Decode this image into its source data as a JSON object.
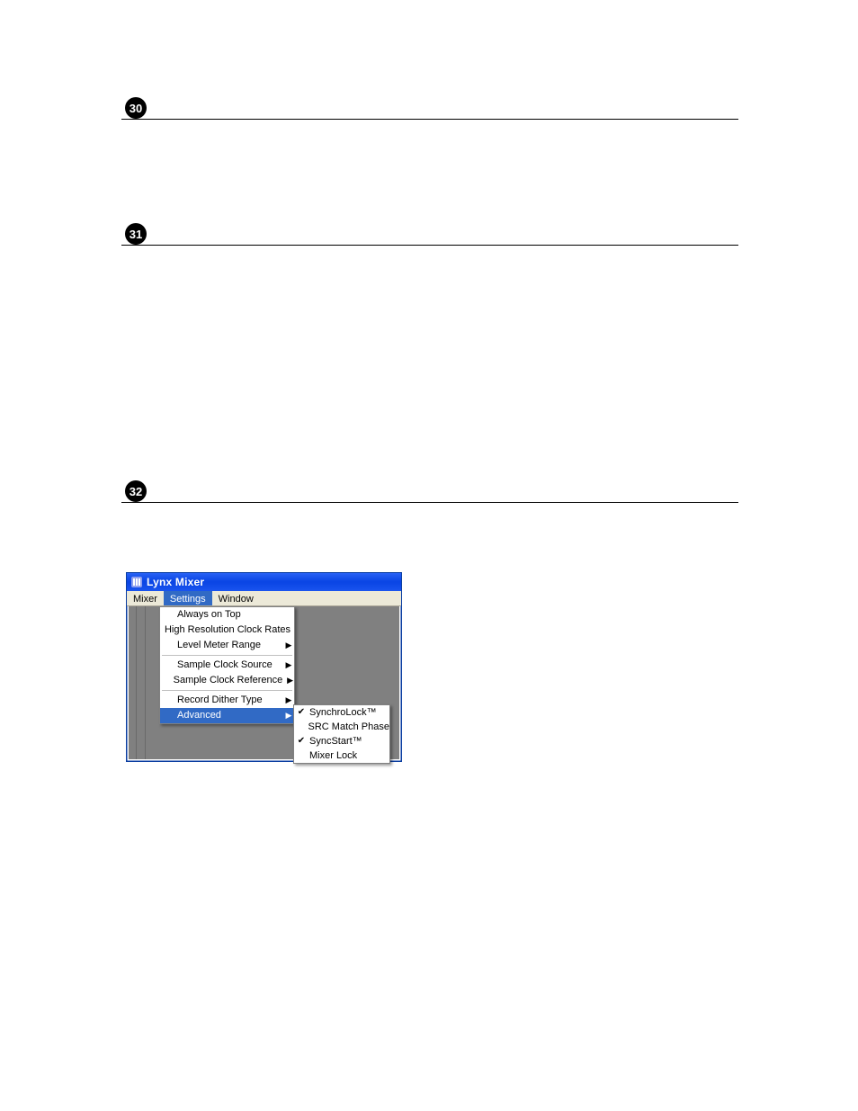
{
  "bullets": {
    "b30": "30",
    "b31": "31",
    "b32": "32"
  },
  "window": {
    "title": "Lynx Mixer",
    "menubar": {
      "items": [
        {
          "label": "Mixer",
          "active": false
        },
        {
          "label": "Settings",
          "active": true
        },
        {
          "label": "Window",
          "active": false
        }
      ]
    }
  },
  "settings_menu": {
    "items": [
      {
        "label": "Always on Top",
        "submenu": false,
        "highlighted": false
      },
      {
        "label": "High Resolution Clock Rates",
        "submenu": false,
        "highlighted": false
      },
      {
        "label": "Level Meter Range",
        "submenu": true,
        "highlighted": false
      },
      {
        "separator": true
      },
      {
        "label": "Sample Clock Source",
        "submenu": true,
        "highlighted": false
      },
      {
        "label": "Sample Clock Reference",
        "submenu": true,
        "highlighted": false
      },
      {
        "separator": true
      },
      {
        "label": "Record Dither Type",
        "submenu": true,
        "highlighted": false
      },
      {
        "label": "Advanced",
        "submenu": true,
        "highlighted": true
      }
    ]
  },
  "advanced_submenu": {
    "items": [
      {
        "label": "SynchroLock™",
        "checked": true
      },
      {
        "label": "SRC Match Phase",
        "checked": false
      },
      {
        "label": "SyncStart™",
        "checked": true
      },
      {
        "label": "Mixer Lock",
        "checked": false
      }
    ]
  }
}
